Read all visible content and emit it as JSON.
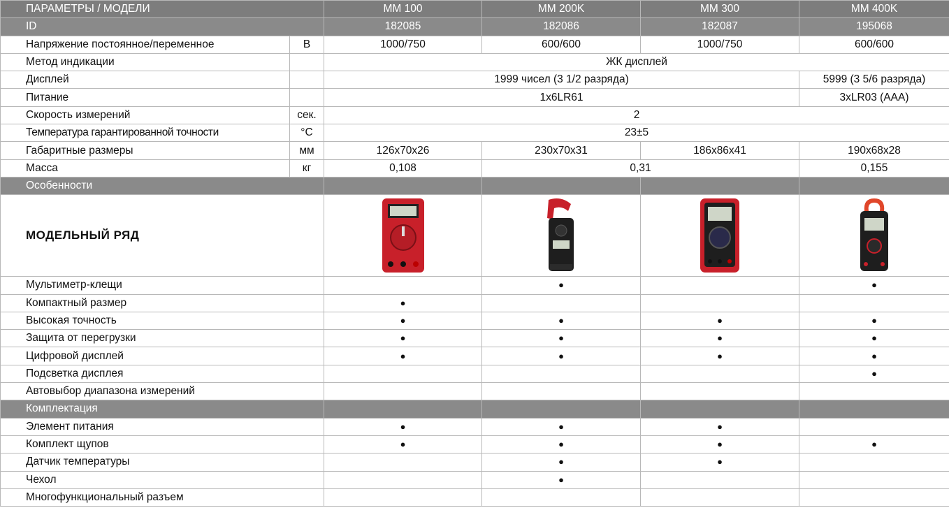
{
  "header": {
    "params_label": "ПАРАМЕТРЫ / МОДЕЛИ",
    "models": [
      "MM 100",
      "MM 200K",
      "MM 300",
      "MM 400K"
    ],
    "id_label": "ID",
    "ids": [
      "182085",
      "182086",
      "182087",
      "195068"
    ]
  },
  "specs": {
    "voltage": {
      "label": "Напряжение постоянное/переменное",
      "unit": "В",
      "values": [
        "1000/750",
        "600/600",
        "1000/750",
        "600/600"
      ]
    },
    "indication": {
      "label": "Метод индикации",
      "value": "ЖК дисплей"
    },
    "display": {
      "label": "Дисплей",
      "value_a": "1999 чисел (3 1/2 разряда)",
      "value_b": "5999 (3 5/6 разряда)"
    },
    "power": {
      "label": "Питание",
      "value_a": "1x6LR61",
      "value_b": "3xLR03 (AAA)"
    },
    "speed": {
      "label": "Скорость измерений",
      "unit": "сек.",
      "value": "2"
    },
    "temperature": {
      "label": "Температура гарантированной точности",
      "unit": "°C",
      "value": "23±5"
    },
    "dimensions": {
      "label": "Габаритные размеры",
      "unit": "мм",
      "values": [
        "126x70x26",
        "230x70x31",
        "186x86x41",
        "190x68x28"
      ]
    },
    "mass": {
      "label": "Масса",
      "unit": "кг",
      "value_a": "0,108",
      "value_b": "0,31",
      "value_c": "0,155"
    }
  },
  "features": {
    "section_label": "Особенности",
    "series_title": "МОДЕЛЬНЫЙ РЯД",
    "dot": "●",
    "rows": [
      {
        "label": "Мультиметр-клещи",
        "marks": [
          false,
          true,
          false,
          true
        ]
      },
      {
        "label": "Компактный размер",
        "marks": [
          true,
          false,
          false,
          false
        ]
      },
      {
        "label": "Высокая точность",
        "marks": [
          true,
          true,
          true,
          true
        ]
      },
      {
        "label": "Защита от перегрузки",
        "marks": [
          true,
          true,
          true,
          true
        ]
      },
      {
        "label": "Цифровой дисплей",
        "marks": [
          true,
          true,
          true,
          true
        ]
      },
      {
        "label": "Подсветка дисплея",
        "marks": [
          false,
          false,
          false,
          true
        ]
      },
      {
        "label": "Автовыбор диапазона измерений",
        "marks": [
          false,
          false,
          false,
          false
        ]
      }
    ]
  },
  "package": {
    "section_label": "Комплектация",
    "rows": [
      {
        "label": "Элемент питания",
        "marks": [
          true,
          true,
          true,
          false
        ]
      },
      {
        "label": "Комплект щупов",
        "marks": [
          true,
          true,
          true,
          true
        ]
      },
      {
        "label": "Датчик температуры",
        "marks": [
          false,
          true,
          true,
          false
        ]
      },
      {
        "label": "Чехол",
        "marks": [
          false,
          true,
          false,
          false
        ]
      },
      {
        "label": "Многофункциональный разъем",
        "marks": [
          false,
          false,
          false,
          false
        ]
      }
    ]
  },
  "colors": {
    "header_bg": "#7d7d7d",
    "device_red": "#c8202a",
    "device_black": "#1e1e1e"
  }
}
